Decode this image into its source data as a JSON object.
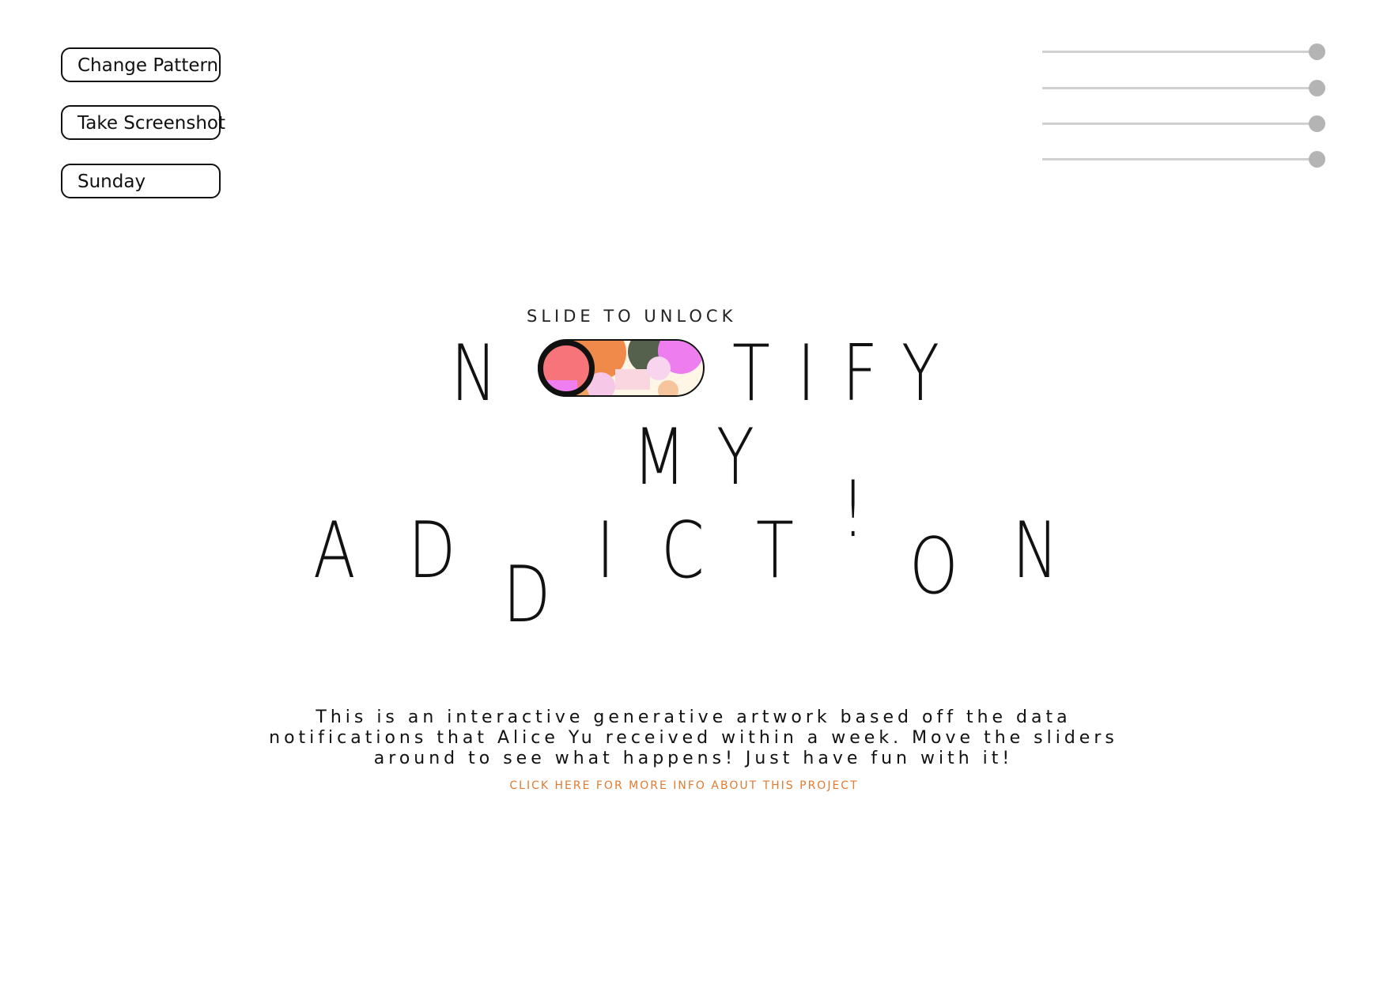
{
  "buttons": {
    "change_pattern": "Change Pattern",
    "take_screenshot": "Take Screenshot",
    "day": "Sunday"
  },
  "sliders": [
    {
      "value": 1.0
    },
    {
      "value": 1.0
    },
    {
      "value": 1.0
    },
    {
      "value": 1.0
    }
  ],
  "title": {
    "unlock_label": "SLIDE TO UNLOCK",
    "line1": [
      "N",
      "T",
      "I",
      "F",
      "Y"
    ],
    "line2": [
      "M",
      "Y"
    ],
    "line3": [
      "A",
      "D",
      "D",
      "I",
      "C",
      "T",
      "!",
      "O",
      "N"
    ]
  },
  "description": {
    "text": "This is an interactive generative artwork based off the data notifications that Alice Yu received within a week. Move the sliders around to see what happens! Just have fun with it!",
    "link": "CLICK HERE FOR MORE INFO ABOUT THIS PROJECT"
  },
  "colors": {
    "accent": "#e07b32",
    "slider_thumb": "#b4b4b4",
    "slider_track": "#d0d0d0"
  }
}
